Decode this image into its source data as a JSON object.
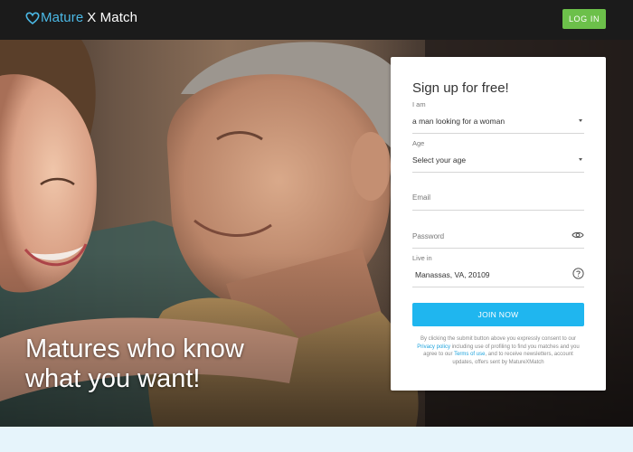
{
  "header": {
    "logo_part1": "Mature",
    "logo_part2": "X Match",
    "login_label": "LOG IN"
  },
  "hero": {
    "headline_line1": "Matures who know",
    "headline_line2": "what you want!"
  },
  "signup": {
    "title": "Sign up for free!",
    "iam_label": "I am",
    "iam_value": "a man looking for a woman",
    "age_label": "Age",
    "age_value": "Select your age",
    "email_label": "Email",
    "password_label": "Password",
    "live_label": "Live in",
    "live_value": "Manassas, VA, 20109",
    "join_label": "JOIN NOW",
    "legal_part1": "By clicking the submit button above you expressly consent to our",
    "privacy_link": "Privacy policy",
    "legal_part2": "including use of profiling to find you matches and you agree to our",
    "terms_link": "Terms of use",
    "legal_part3": ", and to receive newsletters, account updates, offers sent by MatureXMatch"
  },
  "colors": {
    "topbar": "#1b1b1b",
    "brand_blue": "#4bb9e6",
    "login_green": "#6cc04a",
    "join_blue": "#1fb6ef",
    "page_bg": "#e6f4fb"
  },
  "icons": [
    "heart-logo-icon",
    "caret-down-icon",
    "eye-icon",
    "help-circle-icon"
  ]
}
